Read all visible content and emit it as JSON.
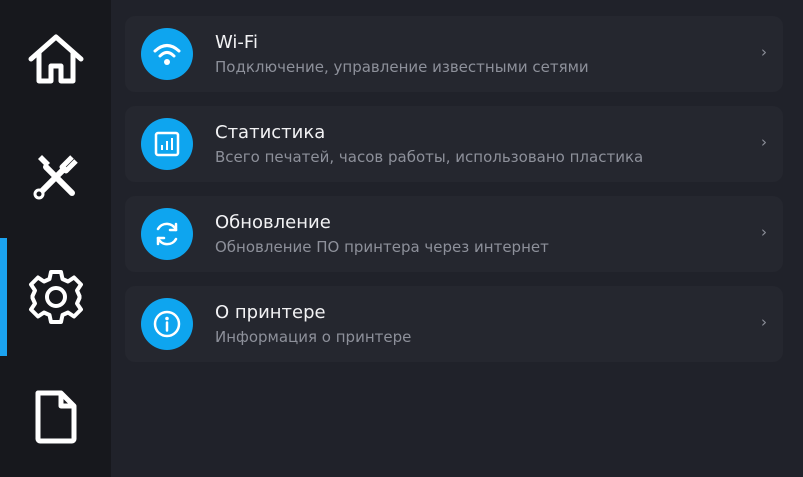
{
  "colors": {
    "accent": "#1ba3f0",
    "icon_circle": "#0ea5ef",
    "sidebar_bg": "#17181d",
    "content_bg": "#20222a",
    "card_bg": "#25272f",
    "title_text": "#f2f2f4",
    "subtitle_text": "#8d909a"
  },
  "sidebar": {
    "items": [
      {
        "icon": "home-icon",
        "active": false
      },
      {
        "icon": "tools-icon",
        "active": false
      },
      {
        "icon": "gear-icon",
        "active": true
      },
      {
        "icon": "file-icon",
        "active": false
      }
    ]
  },
  "settings": {
    "items": [
      {
        "icon": "wifi-icon",
        "title": "Wi-Fi",
        "subtitle": "Подключение, управление известными сетями",
        "chevron": "›"
      },
      {
        "icon": "statistics-icon",
        "title": "Статистика",
        "subtitle": "Всего печатей, часов работы, использовано пластика",
        "chevron": "›"
      },
      {
        "icon": "refresh-icon",
        "title": "Обновление",
        "subtitle": "Обновление ПО принтера через интернет",
        "chevron": "›"
      },
      {
        "icon": "info-icon",
        "title": "О принтере",
        "subtitle": "Информация о принтере",
        "chevron": "›"
      }
    ]
  }
}
